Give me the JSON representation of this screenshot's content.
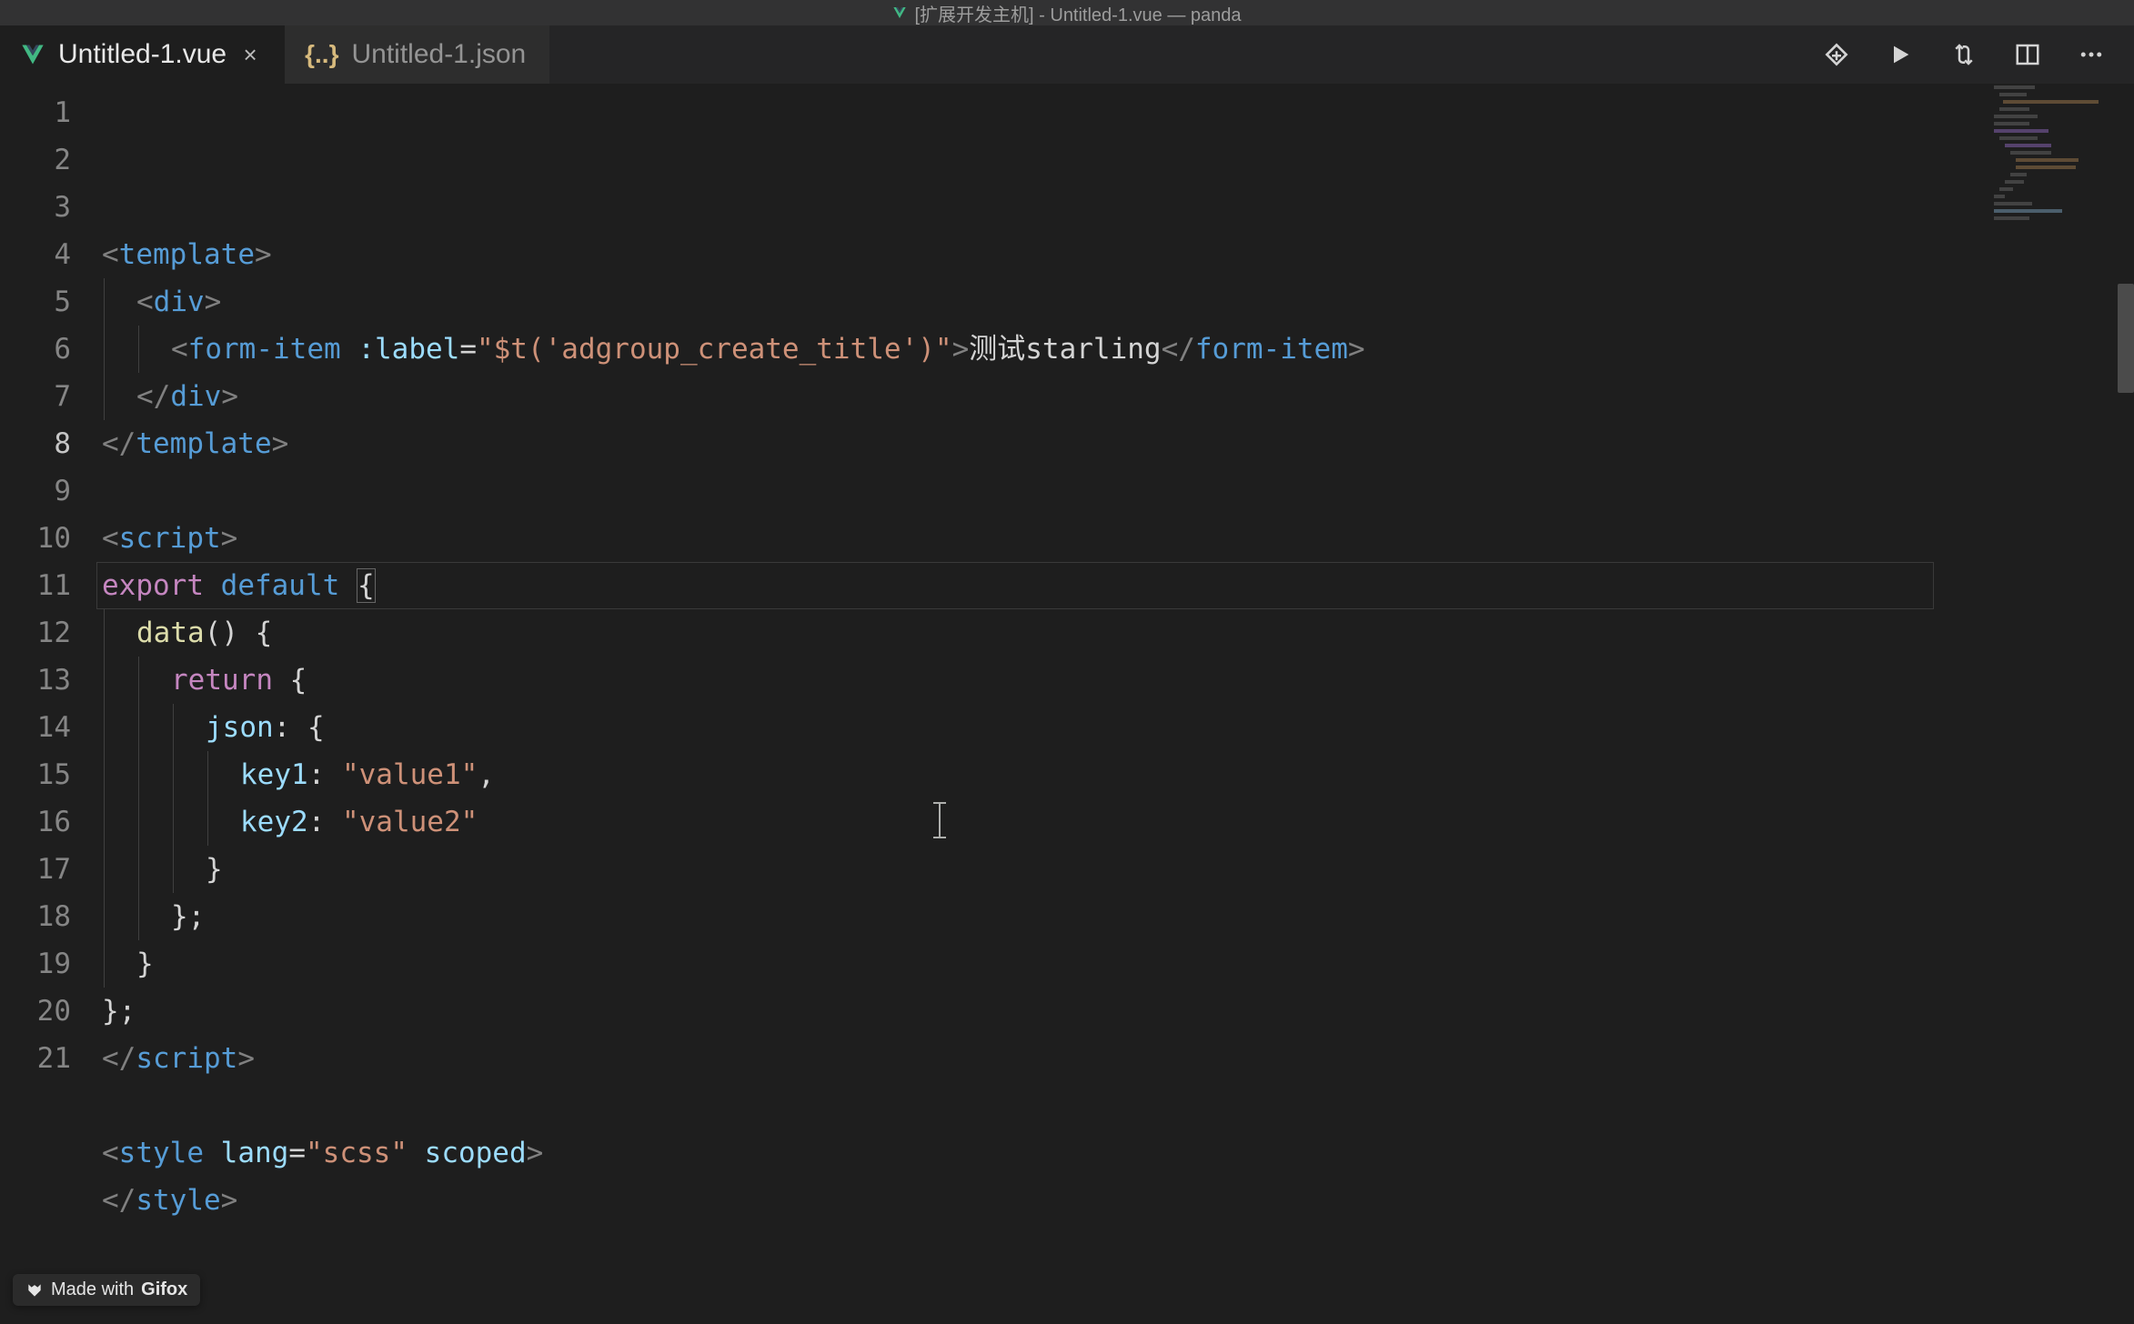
{
  "titlebar": {
    "text": "[扩展开发主机] - Untitled-1.vue — panda"
  },
  "tabs": [
    {
      "label": "Untitled-1.vue",
      "kind": "vue",
      "active": true,
      "closeable": true
    },
    {
      "label": "Untitled-1.json",
      "kind": "json",
      "active": false,
      "closeable": false
    }
  ],
  "editor_actions": {
    "git_branch": "git",
    "run": "run",
    "compare": "compare",
    "split": "split",
    "more": "more"
  },
  "gutter": {
    "start": 1,
    "end": 21,
    "current": 8
  },
  "code": {
    "lines": [
      {
        "n": 1,
        "tokens": [
          [
            "p",
            "<"
          ],
          [
            "tN",
            "template"
          ],
          [
            "p",
            ">"
          ]
        ]
      },
      {
        "n": 2,
        "indent": 1,
        "tokens": [
          [
            "p",
            "<"
          ],
          [
            "tN",
            "div"
          ],
          [
            "p",
            ">"
          ]
        ]
      },
      {
        "n": 3,
        "indent": 2,
        "tokens": [
          [
            "p",
            "<"
          ],
          [
            "tN",
            "form-item"
          ],
          [
            "txt",
            " "
          ],
          [
            "attr",
            ":label"
          ],
          [
            "op",
            "="
          ],
          [
            "str",
            "\"$t('adgroup_create_title')\""
          ],
          [
            "p",
            ">"
          ],
          [
            "txt",
            "测试starling"
          ],
          [
            "p",
            "</"
          ],
          [
            "tN",
            "form-item"
          ],
          [
            "p",
            ">"
          ]
        ]
      },
      {
        "n": 4,
        "indent": 1,
        "tokens": [
          [
            "p",
            "</"
          ],
          [
            "tN",
            "div"
          ],
          [
            "p",
            ">"
          ]
        ]
      },
      {
        "n": 5,
        "tokens": [
          [
            "p",
            "</"
          ],
          [
            "tN",
            "template"
          ],
          [
            "p",
            ">"
          ]
        ]
      },
      {
        "n": 6,
        "tokens": []
      },
      {
        "n": 7,
        "tokens": [
          [
            "p",
            "<"
          ],
          [
            "tN",
            "script"
          ],
          [
            "p",
            ">"
          ]
        ]
      },
      {
        "n": 8,
        "current": true,
        "tokens": [
          [
            "kw",
            "export"
          ],
          [
            "txt",
            " "
          ],
          [
            "kw2",
            "default"
          ],
          [
            "txt",
            " "
          ],
          [
            "txt_brhl",
            "{"
          ]
        ]
      },
      {
        "n": 9,
        "indent": 1,
        "tokens": [
          [
            "fn",
            "data"
          ],
          [
            "txt",
            "() {"
          ]
        ]
      },
      {
        "n": 10,
        "indent": 2,
        "tokens": [
          [
            "kw",
            "return"
          ],
          [
            "txt",
            " {"
          ]
        ]
      },
      {
        "n": 11,
        "indent": 3,
        "tokens": [
          [
            "id",
            "json"
          ],
          [
            "txt",
            ": {"
          ]
        ]
      },
      {
        "n": 12,
        "indent": 4,
        "tokens": [
          [
            "id",
            "key1"
          ],
          [
            "txt",
            ": "
          ],
          [
            "str",
            "\"value1\""
          ],
          [
            "txt",
            ","
          ]
        ]
      },
      {
        "n": 13,
        "indent": 4,
        "tokens": [
          [
            "id",
            "key2"
          ],
          [
            "txt",
            ": "
          ],
          [
            "str",
            "\"value2\""
          ]
        ]
      },
      {
        "n": 14,
        "indent": 3,
        "tokens": [
          [
            "txt",
            "}"
          ]
        ]
      },
      {
        "n": 15,
        "indent": 2,
        "tokens": [
          [
            "txt",
            "};"
          ]
        ]
      },
      {
        "n": 16,
        "indent": 1,
        "tokens": [
          [
            "txt",
            "}"
          ]
        ]
      },
      {
        "n": 17,
        "tokens": [
          [
            "txt",
            "};"
          ]
        ]
      },
      {
        "n": 18,
        "tokens": [
          [
            "p",
            "</"
          ],
          [
            "tN",
            "script"
          ],
          [
            "p",
            ">"
          ]
        ]
      },
      {
        "n": 19,
        "tokens": []
      },
      {
        "n": 20,
        "tokens": [
          [
            "p",
            "<"
          ],
          [
            "tN",
            "style"
          ],
          [
            "txt",
            " "
          ],
          [
            "attr",
            "lang"
          ],
          [
            "op",
            "="
          ],
          [
            "str",
            "\"scss\""
          ],
          [
            "txt",
            " "
          ],
          [
            "attr",
            "scoped"
          ],
          [
            "p",
            ">"
          ]
        ]
      },
      {
        "n": 21,
        "tokens": [
          [
            "p",
            "</"
          ],
          [
            "tN",
            "style"
          ],
          [
            "p",
            ">"
          ]
        ]
      }
    ]
  },
  "gifox": {
    "prefix": "Made with ",
    "brand": "Gifox"
  }
}
